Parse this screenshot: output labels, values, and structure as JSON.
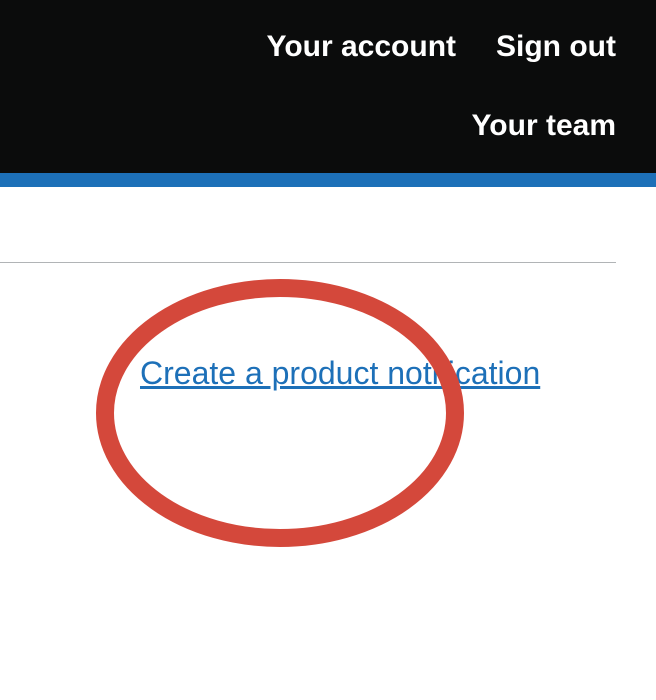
{
  "header": {
    "your_account": "Your account",
    "sign_out": "Sign out",
    "your_team": "Your team"
  },
  "main": {
    "create_link": "Create a product notification"
  },
  "colors": {
    "header_bg": "#0b0c0c",
    "accent_blue": "#1d70b8",
    "link_blue": "#1d70b8",
    "highlight_red": "#d4483b",
    "divider": "#b1b4b6"
  }
}
